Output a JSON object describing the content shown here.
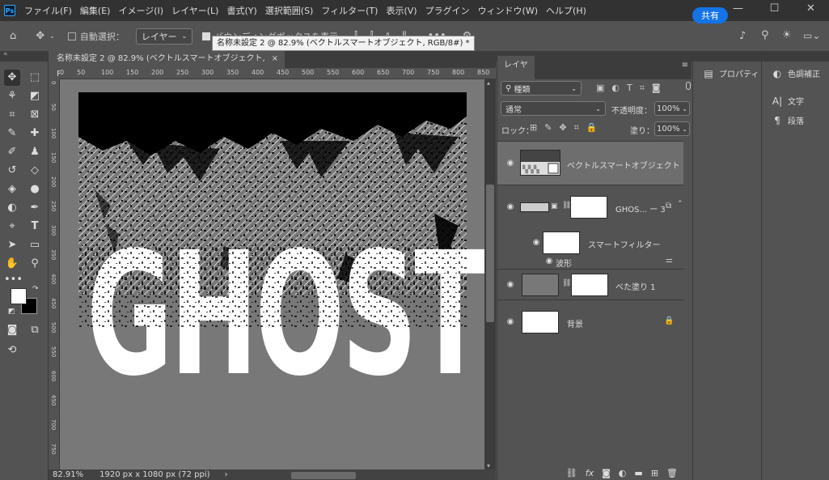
{
  "menubar": {
    "logo": "Ps",
    "items": [
      "ファイル(F)",
      "編集(E)",
      "イメージ(I)",
      "レイヤー(L)",
      "書式(Y)",
      "選択範囲(S)",
      "フィルター(T)",
      "表示(V)",
      "プラグイン",
      "ウィンドウ(W)",
      "ヘルプ(H)"
    ]
  },
  "options": {
    "auto_select_label": "自動選択：",
    "target_select": "レイヤー",
    "bbox_label": "バウンディングボックスを表示",
    "share_label": "共有"
  },
  "tooltip": "名称未設定 2 @ 82.9% (ベクトルスマートオブジェクト, RGB/8#) *",
  "document": {
    "tab_title": "名称未設定 2 @ 82.9% (ベクトルスマートオブジェクト, RGB/8#) *",
    "close": "×",
    "ruler_h": [
      "0",
      "50",
      "100",
      "150",
      "200",
      "250",
      "300",
      "350",
      "400",
      "450",
      "500",
      "550",
      "600",
      "650",
      "700",
      "750",
      "800",
      "850",
      "900"
    ],
    "ruler_v": [
      "0",
      "50",
      "100",
      "150",
      "200",
      "250",
      "300",
      "350",
      "400",
      "450",
      "500",
      "550",
      "600",
      "650",
      "700",
      "750"
    ],
    "canvas_text": "GHOSTS"
  },
  "status": {
    "zoom": "82.91%",
    "size": "1920 px x 1080 px (72 ppi)",
    "arrow": "›"
  },
  "layers_panel": {
    "tab": "レイヤー",
    "filter_kind": "種類",
    "blend_mode": "通常",
    "opacity_label": "不透明度：",
    "opacity_value": "100%",
    "lock_label": "ロック：",
    "fill_label": "塗り：",
    "fill_value": "100%",
    "layers": [
      {
        "name": "ベクトルスマートオブジェクト",
        "selected": true
      },
      {
        "name": "GHOS... ー 3",
        "selected": false
      },
      {
        "name": "スマートフィルター",
        "selected": false
      },
      {
        "name": "波形",
        "selected": false
      },
      {
        "name": "べた塗り 1",
        "selected": false
      },
      {
        "name": "背景",
        "selected": false
      }
    ]
  },
  "properties_panel": {
    "label": "プロパティ"
  },
  "right_panel": {
    "items": [
      "色調補正",
      "文字",
      "段落"
    ]
  },
  "colors": {
    "accent": "#1473e6",
    "canvas_gray": "#787878",
    "panel_bg": "#535353",
    "dark_bar": "#323232"
  }
}
